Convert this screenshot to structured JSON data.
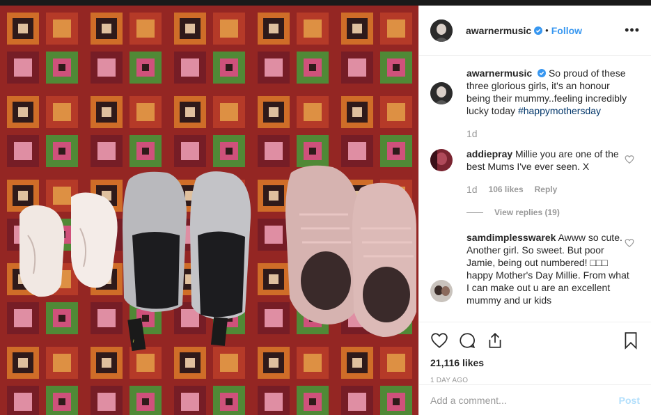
{
  "post": {
    "author": "awarnermusic",
    "follow_label": "Follow",
    "more_label": "•••",
    "caption": "So proud of these three glorious girls, it's an honour being their mummy..feeling incredibly lucky today",
    "hashtag": "#happymothersday",
    "caption_time": "1d",
    "likes": "21,116 likes",
    "posted": "1 DAY AGO"
  },
  "comments": [
    {
      "user": "addiepray",
      "text": "Millie you are one of the best Mums I've ever seen. X",
      "time": "1d",
      "likes": "106 likes",
      "reply_label": "Reply",
      "view_replies": "View replies (19)"
    },
    {
      "user": "samdimplesswarek",
      "text": "Awww so cute. Another girl. So sweet. But poor Jamie, being out numbered! □□□ happy Mother's Day Millie. From what I can make out u are an excellent mummy and ur kids"
    }
  ],
  "add_comment": {
    "placeholder": "Add a comment...",
    "post_label": "Post"
  },
  "icons": [
    "heart-icon",
    "comment-icon",
    "share-icon",
    "bookmark-icon",
    "verified-badge-icon",
    "more-icon"
  ],
  "colors": {
    "accent": "#3897f0",
    "hashtag": "#003569",
    "muted": "#999999",
    "post_disabled": "#b2dffc"
  }
}
